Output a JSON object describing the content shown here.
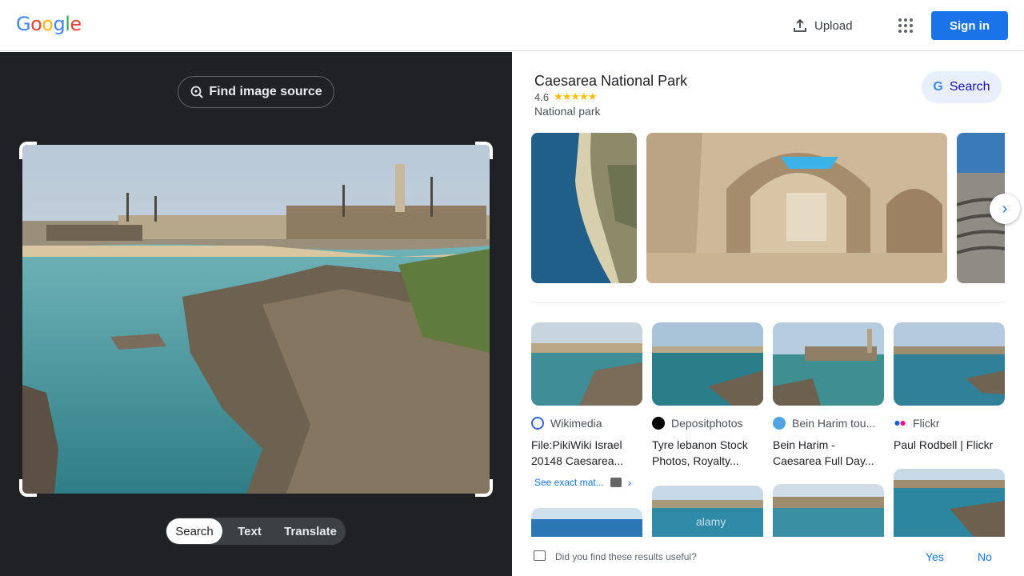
{
  "header": {
    "logo": "Google",
    "upload_label": "Upload",
    "signin_label": "Sign in"
  },
  "left": {
    "find_source_label": "Find image source",
    "modes": [
      "Search",
      "Text",
      "Translate"
    ],
    "active_mode": "Search"
  },
  "knowledge_panel": {
    "title": "Caesarea National Park",
    "rating": "4.6",
    "stars": "★★★★★",
    "type": "National park",
    "search_label": "Search"
  },
  "results": [
    {
      "source": "Wikimedia",
      "title": "File:PikiWiki Israel 20148 Caesarea...",
      "favicon_color": "#3366cc"
    },
    {
      "source": "Depositphotos",
      "title": "Tyre lebanon Stock Photos, Royalty...",
      "favicon_color": "#000000"
    },
    {
      "source": "Bein Harim tou...",
      "title": "Bein Harim - Caesarea Full Day...",
      "favicon_color": "#4fa3e0"
    },
    {
      "source": "Flickr",
      "title": "Paul Rodbell | Flickr",
      "favicon_color": "#0063dc"
    }
  ],
  "exact_matches_label": "See exact mat...",
  "feedback": {
    "question": "Did you find these results useful?",
    "yes": "Yes",
    "no": "No"
  },
  "colors": {
    "accent": "#1a73e8",
    "left_bg": "#202124",
    "star": "#fbbc04"
  }
}
